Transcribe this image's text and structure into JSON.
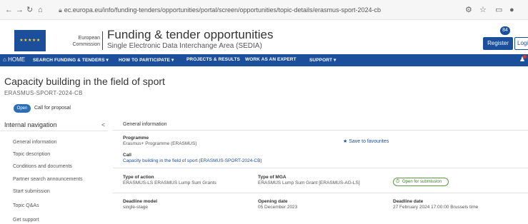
{
  "browser": {
    "url": "ec.europa.eu/info/funding-tenders/opportunities/portal/screen/opportunities/topic-details/erasmus-sport-2024-cb",
    "back": "←",
    "forward": "→",
    "reload": "↻",
    "home": "⌂"
  },
  "header": {
    "ec_name_line1": "European",
    "ec_name_line2": "Commission",
    "title": "Funding & tender opportunities",
    "subtitle": "Single Electronic Data Interchange Area (SEDIA)",
    "notifications_count": "84",
    "register_label": "Register",
    "login_label": "Login"
  },
  "nav": {
    "home": "HOME",
    "items": [
      "SEARCH FUNDING & TENDERS ▾",
      "HOW TO PARTICIPATE ▾",
      "PROJECTS & RESULTS",
      "WORK AS AN EXPERT",
      "SUPPORT ▾"
    ]
  },
  "page": {
    "title": "Capacity building in the field of sport",
    "identifier": "ERASMUS-SPORT-2024-CB",
    "status_badge": "Open",
    "status_text": "Call for proposal"
  },
  "sidebar": {
    "header": "Internal navigation",
    "collapse": "<",
    "items": [
      "General information",
      "Topic description",
      "Conditions and documents",
      "Partner search announcements",
      "Start submission",
      "Topic Q&As",
      "Get support"
    ]
  },
  "general_info": {
    "section_title": "General information",
    "programme_label": "Programme",
    "programme_value": "Erasmus+ Programme (ERASMUS)",
    "save_search": "Save to favourites",
    "call_label": "Call",
    "call_value": "Capacity building in the field of sport (ERASMUS-SPORT-2024-CB)",
    "action_label": "Type of action",
    "action_value": "ERASMUS-LS ERASMUS Lump Sum Grants",
    "mga_label": "Type of MGA",
    "mga_value": "ERASMUS Lump Sum Grant [ERASMUS-AG-LS]",
    "status_chip": "Open for submission",
    "model_label": "Deadline model",
    "model_value": "single-stage",
    "opening_label": "Opening date",
    "opening_value": "05 December 2023",
    "deadline_label": "Deadline date",
    "deadline_value": "27 February 2024 17:00:00 Brussels time"
  }
}
